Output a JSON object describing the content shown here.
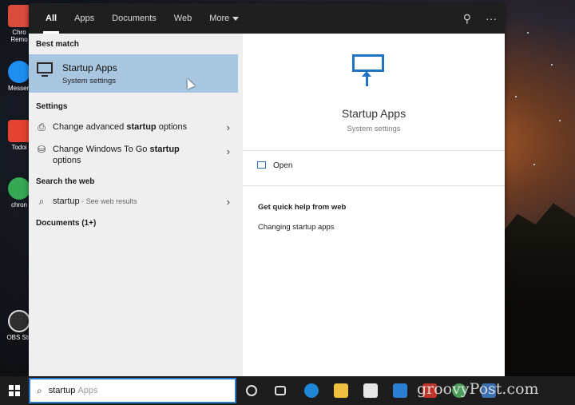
{
  "tabs": [
    {
      "label": "All"
    },
    {
      "label": "Apps"
    },
    {
      "label": "Documents"
    },
    {
      "label": "Web"
    },
    {
      "label": "More"
    }
  ],
  "toolbar_icons": [
    "feedback-icon",
    "more-options-icon"
  ],
  "desktop_icons": [
    {
      "label": "Chro Remo",
      "color": "#d94b3d"
    },
    {
      "label": "Messen",
      "color": "#1f8ef1"
    },
    {
      "label": "Todoi",
      "color": "#e44332"
    },
    {
      "label": "chron",
      "color": "#34a853"
    },
    {
      "label": "OBS Stu",
      "color": "#303030"
    }
  ],
  "left": {
    "best_match_heading": "Best match",
    "best_match": {
      "title": "Startup Apps",
      "subtitle": "System settings"
    },
    "settings_heading": "Settings",
    "settings_items": [
      {
        "prefix": "Change advanced ",
        "bold": "startup",
        "suffix": " options"
      },
      {
        "prefix": "Change Windows To Go ",
        "bold": "startup",
        "suffix": " options"
      }
    ],
    "web_heading": "Search the web",
    "web_item": {
      "query": "startup",
      "hint": " - See web results"
    },
    "documents_heading": "Documents (1+)"
  },
  "right": {
    "title": "Startup Apps",
    "subtitle": "System settings",
    "open_label": "Open",
    "web_help_heading": "Get quick help from web",
    "web_help_link": "Changing startup apps"
  },
  "search": {
    "typed": "startup",
    "suggestion": "Apps"
  },
  "watermark": "groovyPost.com",
  "colors": {
    "accent": "#1f72c4",
    "selected": "#a8c6e0",
    "tabbar": "#1f1f1f"
  }
}
